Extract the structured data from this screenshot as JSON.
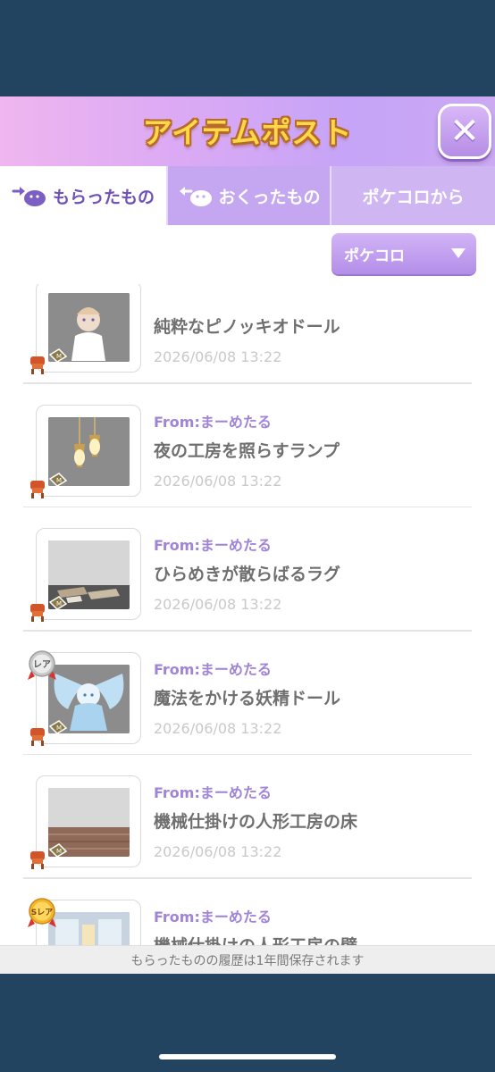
{
  "header": {
    "title": "アイテムポスト",
    "close_icon": "close-icon"
  },
  "tabs": [
    {
      "label": "もらったもの",
      "icon": "received-icon",
      "active": true
    },
    {
      "label": "おくったもの",
      "icon": "sent-icon",
      "active": false
    },
    {
      "label": "ポケコロから",
      "active": false
    }
  ],
  "filter": {
    "selected": "ポケコロ"
  },
  "items": [
    {
      "from": "",
      "name": "純粋なピノッキオドール",
      "date": "2026/06/08 13:22",
      "rarity": ""
    },
    {
      "from": "From:まーめたる",
      "name": "夜の工房を照らすランプ",
      "date": "2026/06/08 13:22",
      "rarity": ""
    },
    {
      "from": "From:まーめたる",
      "name": "ひらめきが散らばるラグ",
      "date": "2026/06/08 13:22",
      "rarity": ""
    },
    {
      "from": "From:まーめたる",
      "name": "魔法をかける妖精ドール",
      "date": "2026/06/08 13:22",
      "rarity": "レア"
    },
    {
      "from": "From:まーめたる",
      "name": "機械仕掛けの人形工房の床",
      "date": "2026/06/08 13:22",
      "rarity": ""
    },
    {
      "from": "From:まーめたる",
      "name": "機械仕掛けの人形工房の壁",
      "date": "",
      "rarity": "Sレア"
    }
  ],
  "footer": {
    "note": "もらったものの履歴は1年間保存されます"
  },
  "colors": {
    "accent": "#9f84d8",
    "header_title": "#ffd84a",
    "background": "#234460"
  }
}
